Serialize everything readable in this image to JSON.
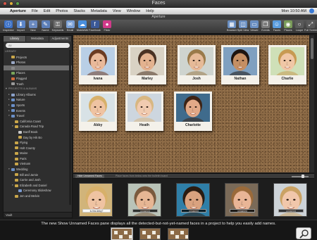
{
  "window": {
    "title": "Faces",
    "app_title": "Aperture"
  },
  "menubar": {
    "apple": "",
    "items": [
      "Aperture",
      "File",
      "Edit",
      "Photos",
      "Stacks",
      "Metadata",
      "View",
      "Window",
      "Help"
    ],
    "clock": "Mon 10:50 AM"
  },
  "toolbar": {
    "left": [
      {
        "label": "Inspector",
        "icon": "inspector-icon",
        "color": "#3a6fc4",
        "glyph": "ⓘ"
      },
      {
        "label": "Import",
        "icon": "import-icon",
        "color": "#5d87c9",
        "glyph": "⬇"
      },
      {
        "label": "New",
        "icon": "new-icon",
        "color": "#6b8ac0",
        "glyph": "+"
      },
      {
        "label": "Name",
        "icon": "name-icon",
        "color": "#5c7fb8",
        "glyph": "✎"
      },
      {
        "label": "Keywords",
        "icon": "keywords-icon",
        "color": "#6d6d6d",
        "glyph": "⚿"
      },
      {
        "label": "Email",
        "icon": "email-icon",
        "color": "#7aa0d6",
        "glyph": "✉"
      },
      {
        "label": "MobileMe",
        "icon": "mobileme-icon",
        "color": "#4a8fdc",
        "glyph": "☁"
      },
      {
        "label": "Facebook",
        "icon": "facebook-icon",
        "color": "#3b5998",
        "glyph": "f"
      },
      {
        "label": "Flickr",
        "icon": "flickr-icon",
        "color": "#d23a8a",
        "glyph": "●"
      }
    ],
    "right": [
      {
        "label": "Browser",
        "icon": "browser-icon",
        "color": "#6a8fc2",
        "glyph": "▦"
      },
      {
        "label": "Split View",
        "icon": "split-view-icon",
        "color": "#6a8fc2",
        "glyph": "◫"
      },
      {
        "label": "Viewer",
        "icon": "viewer-icon",
        "color": "#6a8fc2",
        "glyph": "▭"
      },
      {
        "label": "Events",
        "icon": "events-icon",
        "color": "#7a7a7a",
        "glyph": "❐"
      },
      {
        "label": "Faces",
        "icon": "faces-icon",
        "color": "#5a9de0",
        "glyph": "☺"
      },
      {
        "label": "Places",
        "icon": "places-icon",
        "color": "#7a9c5a",
        "glyph": "◉"
      },
      {
        "label": "Loupe",
        "icon": "loupe-icon",
        "color": "#5a5a5a",
        "glyph": "○"
      },
      {
        "label": "Full Screen",
        "icon": "full-screen-icon",
        "color": "#5a5a5a",
        "glyph": "⤢"
      }
    ]
  },
  "sidebar": {
    "tabs": [
      "Library",
      "Metadata",
      "Adjustments"
    ],
    "active_tab": "Library",
    "filter_placeholder": "All",
    "tree": [
      {
        "label": "LIBRARY",
        "type": "hdr",
        "indent": 0
      },
      {
        "label": "Projects",
        "indent": 1,
        "color": "#c9a64a"
      },
      {
        "label": "Photos",
        "indent": 1,
        "color": "#9aa8c4"
      },
      {
        "label": "",
        "indent": 1,
        "color": "#888",
        "selected": true
      },
      {
        "label": "Places",
        "indent": 1,
        "color": "#7aa55a"
      },
      {
        "label": "Flagged",
        "indent": 1,
        "color": "#d06a3a"
      },
      {
        "label": "Trash",
        "indent": 1,
        "color": "#9a9a9a"
      },
      {
        "label": "▼ PROJECTS & ALBUMS",
        "type": "hdr",
        "indent": 0
      },
      {
        "label": "Library Albums",
        "indent": 1,
        "color": "#8aa0c8",
        "tw": "▸"
      },
      {
        "label": "Nature",
        "indent": 1,
        "color": "#6a8fc8",
        "tw": "▸"
      },
      {
        "label": "Sports",
        "indent": 1,
        "color": "#6a8fc8",
        "tw": "▸"
      },
      {
        "label": "Events",
        "indent": 1,
        "color": "#6a8fc8",
        "tw": "▸"
      },
      {
        "label": "Travel",
        "indent": 1,
        "color": "#6a8fc8",
        "tw": "▾"
      },
      {
        "label": "California Coast",
        "indent": 2,
        "color": "#c9a64a"
      },
      {
        "label": "Canada Road Trip",
        "indent": 2,
        "color": "#c9a64a",
        "tw": "▾"
      },
      {
        "label": "Banff Book",
        "indent": 3,
        "color": "#c9c9c9"
      },
      {
        "label": "Day by Hik Bo",
        "indent": 3,
        "color": "#c9a64a"
      },
      {
        "label": "Flying",
        "indent": 2,
        "color": "#c9a64a"
      },
      {
        "label": "Holt County",
        "indent": 2,
        "color": "#c9a64a"
      },
      {
        "label": "Maine",
        "indent": 2,
        "color": "#c9a64a"
      },
      {
        "label": "Paris",
        "indent": 2,
        "color": "#c9a64a"
      },
      {
        "label": "Vietnam",
        "indent": 2,
        "color": "#c9a64a"
      },
      {
        "label": "Wedding",
        "indent": 1,
        "color": "#6a8fc8",
        "tw": "▾"
      },
      {
        "label": "Bill and Jamie",
        "indent": 2,
        "color": "#c9a64a"
      },
      {
        "label": "Carrie and Josh",
        "indent": 2,
        "color": "#c9a64a"
      },
      {
        "label": "Elizabeth and Daniel",
        "indent": 2,
        "color": "#c9a64a",
        "tw": "▾"
      },
      {
        "label": "Ceremony Slideshow",
        "indent": 3,
        "color": "#7a9ad0"
      },
      {
        "label": "Jen and Melvin",
        "indent": 2,
        "color": "#c9a64a"
      }
    ],
    "footer": "Vault"
  },
  "corkboard": {
    "people": [
      {
        "name": "Ivana",
        "skin": "#e9b99a",
        "hair": "#6b3b22",
        "bg": "#b9cfe6"
      },
      {
        "name": "Marley",
        "skin": "#e3b28f",
        "hair": "#4a3223",
        "bg": "#d9d2c4"
      },
      {
        "name": "Josh",
        "skin": "#e6ba98",
        "hair": "#9a7a4a",
        "bg": "#cfd4cf"
      },
      {
        "name": "Nathan",
        "skin": "#c58f63",
        "hair": "#1e1510",
        "bg": "#7fa0c0"
      },
      {
        "name": "Charlie",
        "skin": "#f0c7a6",
        "hair": "#c79a52",
        "bg": "#cfe0b8"
      },
      {
        "name": "Abby",
        "skin": "#efc3a2",
        "hair": "#d7b06a",
        "bg": "#d8e2e6"
      },
      {
        "name": "Heath",
        "skin": "#f1cbb0",
        "hair": "#d8b782",
        "bg": "#cdd6df"
      },
      {
        "name": "Charlotte",
        "skin": "#e2a988",
        "hair": "#3d2416",
        "bg": "#3f6b8c"
      }
    ]
  },
  "faces_bar": {
    "button_label": "Hide Unnamed Faces",
    "hint": "Place faces from below onto the bulletin board"
  },
  "unnamed_faces": [
    {
      "label": "Is this Abby?",
      "skin": "#efc3a2",
      "hair": "#d7b06a",
      "bg": "#d1b47a",
      "active": true
    },
    {
      "label": "unnamed",
      "skin": "#e6b694",
      "hair": "#7a5a3e",
      "bg": "#b9c3b8"
    },
    {
      "label": "unnamed",
      "skin": "#d9a27f",
      "hair": "#2a1c12",
      "bg": "#2f7fa8"
    },
    {
      "label": "unnamed",
      "skin": "#e9b596",
      "hair": "#9a6a3a",
      "bg": "#7a6a58"
    },
    {
      "label": "unnamed",
      "skin": "#f1c7ab",
      "hair": "#caa264",
      "bg": "#cdd3d8"
    }
  ],
  "caption": "The new Show Unnamed Faces pane displays all the detected-but-not-yet-named faces in a project to help you easily add names.",
  "thumbnails": 3
}
